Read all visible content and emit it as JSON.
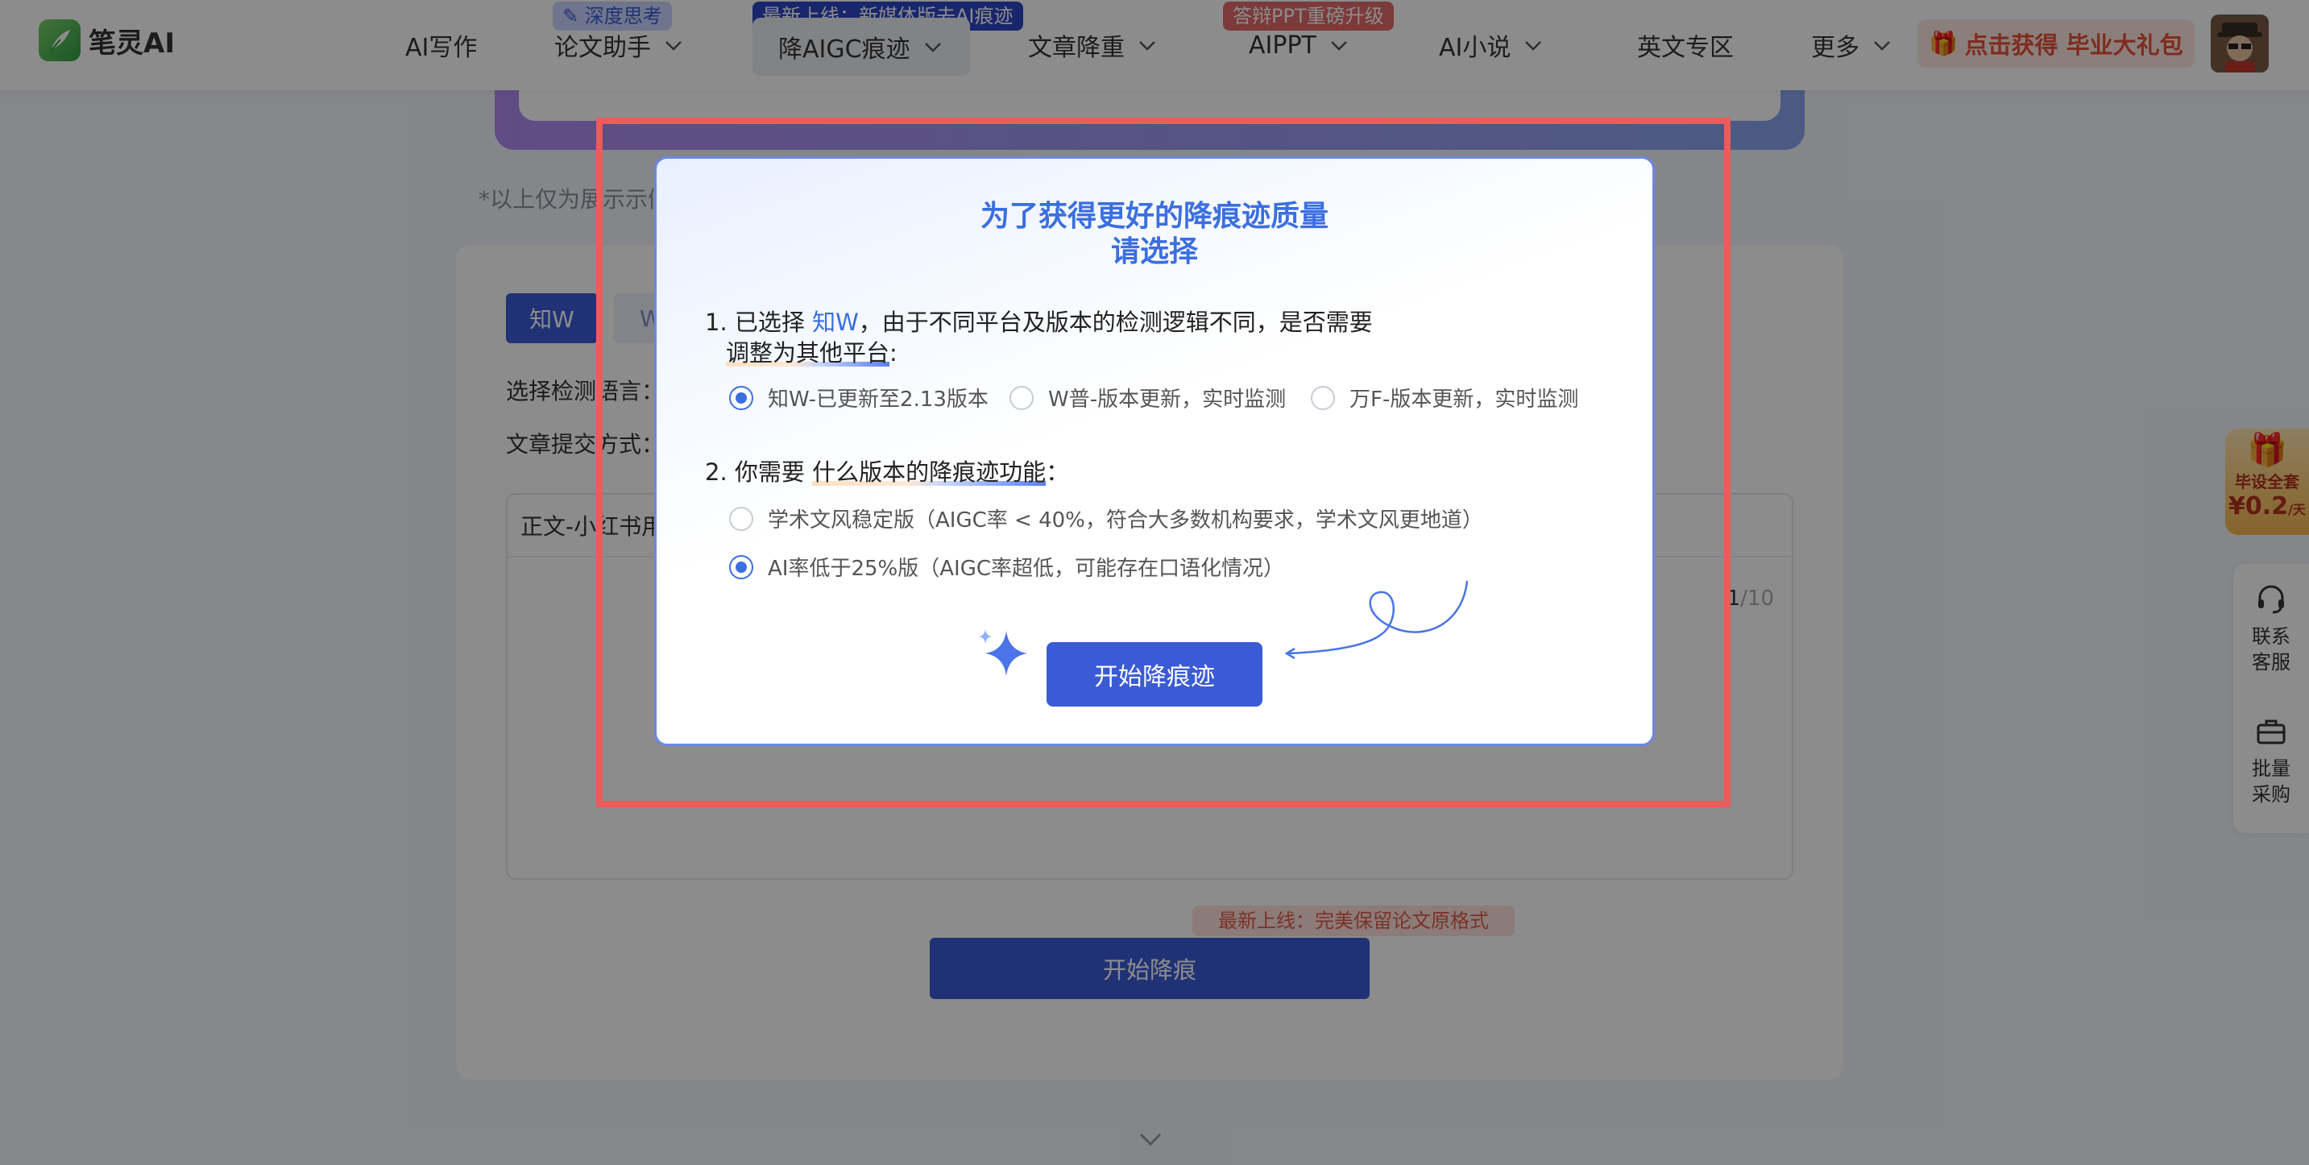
{
  "nav": {
    "logo_text": "笔灵AI",
    "items": [
      {
        "label": "AI写作",
        "has_menu": false
      },
      {
        "label": "论文助手",
        "has_menu": true,
        "badge": "深度思考"
      },
      {
        "label": "降AIGC痕迹",
        "has_menu": true,
        "badge": "最新上线：新媒体版去AI痕迹",
        "active": true
      },
      {
        "label": "文章降重",
        "has_menu": true
      },
      {
        "label": "AIPPT",
        "has_menu": true,
        "badge": "答辩PPT重磅升级"
      },
      {
        "label": "AI小说",
        "has_menu": true
      },
      {
        "label": "英文专区",
        "has_menu": false
      },
      {
        "label": "更多",
        "has_menu": true
      }
    ],
    "gift_button": "点击获得 毕业大礼包",
    "colors": {
      "brand": "#3b5bd5",
      "gift_text": "#e8503a"
    }
  },
  "page": {
    "demo_note": "*以上仅为展示示例",
    "tabs": [
      "知W",
      "W"
    ],
    "label_language": "选择检测语言：",
    "label_submit_mode": "文章提交方式：",
    "editor_head": "正文-小红书用",
    "counter_current": "1",
    "counter_total": "/10",
    "promo_tag": "最新上线：完美保留论文原格式",
    "submit_button": "开始降痕"
  },
  "side": {
    "gift_line1": "毕设全套",
    "gift_price": "¥0.2",
    "gift_unit": "/天",
    "contact": [
      "联系",
      "客服"
    ],
    "bulk": [
      "批量",
      "采购"
    ]
  },
  "modal": {
    "title_line1": "为了获得更好的降痕迹质量",
    "title_line2": "请选择",
    "q1": {
      "prefix": "1. 已选择 ",
      "selected": "知W",
      "middle": "，由于不同平台及版本的检测逻辑不同，是否需要",
      "emph": "调整为其他平台",
      "suffix": ":",
      "options": [
        {
          "label": "知W-已更新至2.13版本",
          "checked": true
        },
        {
          "label": "W普-版本更新，实时监测",
          "checked": false
        },
        {
          "label": "万F-版本更新，实时监测",
          "checked": false
        }
      ]
    },
    "q2": {
      "prefix": "2. 你需要 ",
      "emph": "什么版本的降痕迹功能",
      "suffix": "：",
      "options": [
        {
          "label": "学术文风稳定版（AIGC率 < 40%，符合大多数机构要求，学术文风更地道）",
          "checked": false
        },
        {
          "label": "AI率低于25%版（AIGC率超低，可能存在口语化情况）",
          "checked": true
        }
      ]
    },
    "start_button": "开始降痕迹",
    "accent_color": "#3b6fe0",
    "highlight_frame_color": "#ef5a5a"
  }
}
